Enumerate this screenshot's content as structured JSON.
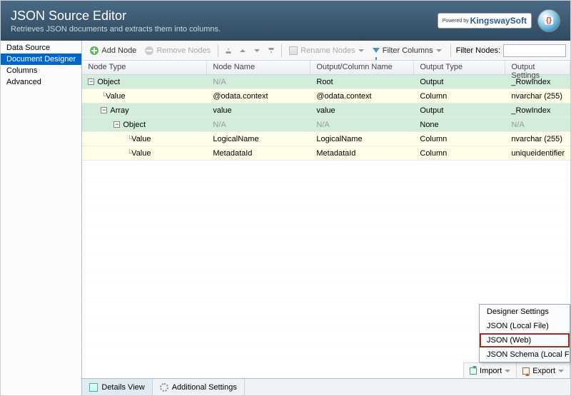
{
  "header": {
    "title": "JSON Source Editor",
    "subtitle": "Retrieves JSON documents and extracts them into columns.",
    "powered_prefix": "Powered by",
    "brand": "KingswaySoft"
  },
  "sidebar": {
    "items": [
      {
        "label": "Data Source",
        "selected": false
      },
      {
        "label": "Document Designer",
        "selected": true
      },
      {
        "label": "Columns",
        "selected": false
      },
      {
        "label": "Advanced",
        "selected": false
      }
    ]
  },
  "toolbar": {
    "add": "Add Node",
    "remove": "Remove Nodes",
    "rename": "Rename Nodes",
    "filter_columns": "Filter Columns",
    "filter_nodes": "Filter Nodes:",
    "filter_value": ""
  },
  "grid": {
    "headers": {
      "node_type": "Node Type",
      "node_name": "Node Name",
      "output_col": "Output/Column Name",
      "output_type": "Output Type",
      "output_settings": "Output Settings"
    },
    "rows": [
      {
        "indent": 0,
        "expandable": true,
        "color": "green",
        "type": "Object",
        "name": "N/A",
        "name_na": true,
        "col": "Root",
        "otype": "Output",
        "oset": "_RowIndex"
      },
      {
        "indent": 1,
        "expandable": false,
        "color": "yellow",
        "type": "Value",
        "name": "@odata.context",
        "col": "@odata.context",
        "otype": "Column",
        "oset": "nvarchar (255)"
      },
      {
        "indent": 1,
        "expandable": true,
        "color": "green",
        "type": "Array",
        "name": "value",
        "col": "value",
        "otype": "Output",
        "oset": "_RowIndex"
      },
      {
        "indent": 2,
        "expandable": true,
        "color": "green",
        "type": "Object",
        "name": "N/A",
        "name_na": true,
        "col": "N/A",
        "col_na": true,
        "otype": "None",
        "oset": "N/A",
        "oset_na": true
      },
      {
        "indent": 3,
        "expandable": false,
        "color": "yellow",
        "type": "Value",
        "name": "LogicalName",
        "col": "LogicalName",
        "otype": "Column",
        "oset": "nvarchar (255)"
      },
      {
        "indent": 3,
        "expandable": false,
        "color": "yellow",
        "type": "Value",
        "name": "MetadataId",
        "col": "MetadataId",
        "otype": "Column",
        "oset": "uniqueidentifier"
      }
    ]
  },
  "footer": {
    "details": "Details View",
    "additional": "Additional Settings"
  },
  "bottom": {
    "import": "Import",
    "export": "Export"
  },
  "popup": {
    "items": [
      {
        "label": "Designer Settings"
      },
      {
        "label": "JSON (Local File)"
      },
      {
        "label": "JSON (Web)",
        "highlighted": true
      },
      {
        "label": "JSON Schema (Local F"
      }
    ]
  }
}
